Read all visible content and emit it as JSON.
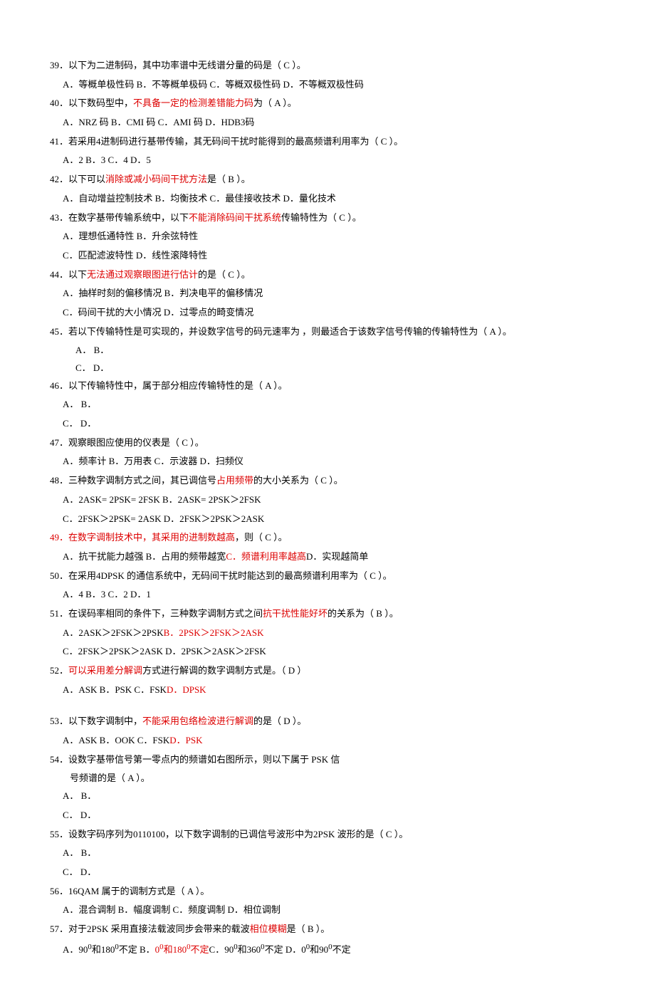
{
  "q39": {
    "text_a": "39．以下为二进制码，其中功率谱中无线谱分量的码是（",
    "ans": "  C    ",
    "text_b": "）。",
    "opts": "A．等概单极性码    B．不等概单极码     C．等概双极性码    D．不等概双极性码"
  },
  "q40": {
    "text_a": "40．以下数码型中，",
    "red": "不具备一定的检测差错能力码",
    "text_b": "为（   A    ）。",
    "opts": "A．NRZ 码          B．CMI 码         C．AMI 码         D．HDB3码"
  },
  "q41": {
    "text": "41．若采用4进制码进行基带传输，其无码间干扰时能得到的最高频谱利用率为（   C    ）。",
    "opts": "A．2         B．3        C．4         D．5"
  },
  "q42": {
    "text_a": "42．以下可以",
    "red": "消除或减小码间干扰方法",
    "text_b": "是（    B   ）。",
    "opts": "A．自动增益控制技术      B．均衡技术    C．最佳接收技术    D．量化技术"
  },
  "q43": {
    "text_a": "43．在数字基带传输系统中，以下",
    "red": "不能消除码间干扰系统",
    "text_b": "传输特性为（   C    ）。",
    "opt1": "A．理想低通特性                   B．升余弦特性",
    "opt2": "C．匹配滤波特性                   D．线性滚降特性"
  },
  "q44": {
    "text_a": "44．以下",
    "red": "无法通过观察眼图进行估计",
    "text_b": "的是（    C   ）。",
    "opt1": "A．抽样时刻的偏移情况              B．判决电平的偏移情况",
    "opt2": "C．码间干扰的大小情况              D．过零点的畸变情况"
  },
  "q45": {
    "text": "45．若以下传输特性是可实现的，并设数字信号的码元速率为 ，则最适合于该数字信号传输的传输特性为（  A     ）。",
    "opt1": "A．                             B．",
    "opt2": "C．                             D．"
  },
  "q46": {
    "text": "46．以下传输特性中，属于部分相应传输特性的是（  A    ）。",
    "opt1": "A．             B．",
    "opt2": "C．             D．"
  },
  "q47": {
    "text": "47．观察眼图应使用的仪表是（  C    ）。",
    "opts": "A．频率计       B．万用表       C．示波器        D．扫频仪"
  },
  "q48": {
    "text_a": "48．三种数字调制方式之间，其已调信号",
    "red": "占用频带",
    "text_b": "的大小关系为（  C   ）。",
    "opt1": "A．2ASK= 2PSK= 2FSK               B．2ASK= 2PSK＞2FSK",
    "opt2": "C．2FSK＞2PSK= 2ASK               D．2FSK＞2PSK＞2ASK"
  },
  "q49": {
    "red": "49．在数字调制技术中，其采用的进制数越高",
    "text_b": "，则（   C     ）。",
    "opt_a": "A．抗干扰能力越强    B．占用的频带越宽   ",
    "opt_c": "C．频谱利用率越高",
    "opt_d": "    D．实现越简单"
  },
  "q50": {
    "text": "50．在采用4DPSK 的通信系统中，无码间干扰时能达到的最高频谱利用率为（   C    ）。",
    "opts": "A．4       B．3       C．2          D．1"
  },
  "q51": {
    "text_a": "51．在误码率相同的条件下，三种数字调制方式之间",
    "red": "抗干扰性能好坏",
    "text_b": "的关系为（   B    ）。",
    "opt1_a": "A．2ASK＞2FSK＞2PSK                 ",
    "opt1_b": "B．2PSK＞2FSK＞2ASK",
    "opt2": "C．2FSK＞2PSK＞2ASK                 D．2PSK＞2ASK＞2FSK"
  },
  "q52": {
    "text_a": "52．",
    "red": "可以采用差分解调",
    "text_b": "方式进行解调的数字调制方式是。（   D    ）",
    "opt_a": "A．ASK            B．PSK          C．FSK            ",
    "opt_d": "D．DPSK"
  },
  "q53": {
    "text_a": "53．以下数字调制中，",
    "red": "不能采用包络检波进行解调",
    "text_b": "的是（   D    ）。",
    "opt_a": "A．ASK            B．OOK           C．FSK            ",
    "opt_d": "D．PSK"
  },
  "q54": {
    "text1": "54．设数字基带信号第一零点内的频谱如右图所示，则以下属于 PSK 信",
    "text2": "号频谱的是（   A    ）。",
    "opt1": "A．                                B．",
    "opt2": "C．                                D．"
  },
  "q55": {
    "text": "55．设数字码序列为0110100，以下数字调制的已调信号波形中为2PSK 波形的是（   C    ）。",
    "opt1": "A．                                 B．",
    "opt2": "C．                                 D．"
  },
  "q56": {
    "text": "56．16QAM 属于的调制方式是（   A    ）。",
    "opts": "A．混合调制          B．幅度调制          C．频度调制         D．相位调制"
  },
  "q57": {
    "text_a": "57．对于2PSK 采用直接法载波同步会带来的载波",
    "red": "相位模糊",
    "text_b": "是（ B     ）。",
    "opt_a": "A．90",
    "opt_a2": "和180",
    "opt_a3": "不定    B．",
    "opt_b": "0",
    "opt_b2": "和180",
    "opt_b3": "不定",
    "opt_c": "    C．90",
    "opt_c2": "和360",
    "opt_c3": "不定      D．0",
    "opt_d2": "和90",
    "opt_d3": "不定",
    "deg": "0"
  }
}
